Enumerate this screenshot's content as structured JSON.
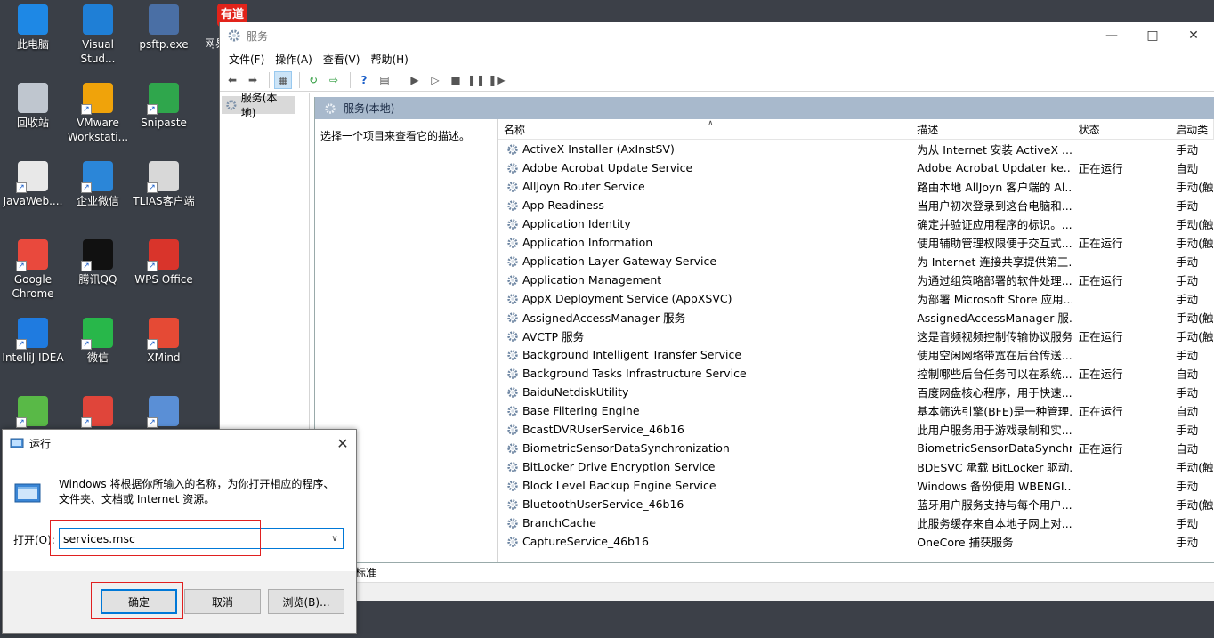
{
  "desktop": {
    "icons": [
      {
        "label": "此电脑",
        "icon": "computer-icon",
        "color": "#1e88e5"
      },
      {
        "label": "Visual Stud...",
        "icon": "vscode-icon",
        "color": "#1f7fd6"
      },
      {
        "label": "psftp.exe",
        "icon": "putty-icon",
        "color": "#4a6fa5"
      },
      {
        "label": "回收站",
        "icon": "recycle-bin-icon",
        "color": "#bfc6cf"
      },
      {
        "label": "VMware Workstati...",
        "icon": "vmware-icon",
        "color": "#f0a30a"
      },
      {
        "label": "Snipaste",
        "icon": "snipaste-icon",
        "color": "#2fa64c"
      },
      {
        "label": "JavaWeb....",
        "icon": "markdown-file-icon",
        "color": "#e8e8e8"
      },
      {
        "label": "企业微信",
        "icon": "wecom-icon",
        "color": "#2b86d8"
      },
      {
        "label": "TLIAS客户端",
        "icon": "tlias-icon",
        "color": "#d8d8d8"
      },
      {
        "label": "Google Chrome",
        "icon": "chrome-icon",
        "color": "#e9493d"
      },
      {
        "label": "腾讯QQ",
        "icon": "qq-icon",
        "color": "#111111"
      },
      {
        "label": "WPS Office",
        "icon": "wps-icon",
        "color": "#d9342b"
      },
      {
        "label": "IntelliJ IDEA",
        "icon": "intellij-icon",
        "color": "#1f7be0"
      },
      {
        "label": "微信",
        "icon": "wechat-icon",
        "color": "#28b74a"
      },
      {
        "label": "XMind",
        "icon": "xmind-icon",
        "color": "#e54a35"
      },
      {
        "label": "",
        "icon": "green-app-icon",
        "color": "#59b947"
      },
      {
        "label": "",
        "icon": "red-doc-icon",
        "color": "#e0453a"
      },
      {
        "label": "",
        "icon": "search-tool-icon",
        "color": "#5a8fd6"
      }
    ],
    "youdao_badge": "有道",
    "youdao_label": "网易"
  },
  "services_window": {
    "title": "服务",
    "menu": [
      "文件(F)",
      "操作(A)",
      "查看(V)",
      "帮助(H)"
    ],
    "tree_node": "服务(本地)",
    "pane_title": "服务(本地)",
    "desc_prompt": "选择一个项目来查看它的描述。",
    "columns": [
      "名称",
      "描述",
      "状态",
      "启动类"
    ],
    "rows": [
      {
        "name": "ActiveX Installer (AxInstSV)",
        "desc": "为从 Internet 安装 ActiveX ...",
        "state": "",
        "start": "手动"
      },
      {
        "name": "Adobe Acrobat Update Service",
        "desc": "Adobe Acrobat Updater ke...",
        "state": "正在运行",
        "start": "自动"
      },
      {
        "name": "AllJoyn Router Service",
        "desc": "路由本地 AllJoyn 客户端的 Al...",
        "state": "",
        "start": "手动(触"
      },
      {
        "name": "App Readiness",
        "desc": "当用户初次登录到这台电脑和...",
        "state": "",
        "start": "手动"
      },
      {
        "name": "Application Identity",
        "desc": "确定并验证应用程序的标识。...",
        "state": "",
        "start": "手动(触"
      },
      {
        "name": "Application Information",
        "desc": "使用辅助管理权限便于交互式...",
        "state": "正在运行",
        "start": "手动(触"
      },
      {
        "name": "Application Layer Gateway Service",
        "desc": "为 Internet 连接共享提供第三...",
        "state": "",
        "start": "手动"
      },
      {
        "name": "Application Management",
        "desc": "为通过组策略部署的软件处理...",
        "state": "正在运行",
        "start": "手动"
      },
      {
        "name": "AppX Deployment Service (AppXSVC)",
        "desc": "为部署 Microsoft Store 应用...",
        "state": "",
        "start": "手动"
      },
      {
        "name": "AssignedAccessManager 服务",
        "desc": "AssignedAccessManager 服...",
        "state": "",
        "start": "手动(触"
      },
      {
        "name": "AVCTP 服务",
        "desc": "这是音频视频控制传输协议服务",
        "state": "正在运行",
        "start": "手动(触"
      },
      {
        "name": "Background Intelligent Transfer Service",
        "desc": "使用空闲网络带宽在后台传送...",
        "state": "",
        "start": "手动"
      },
      {
        "name": "Background Tasks Infrastructure Service",
        "desc": "控制哪些后台任务可以在系统...",
        "state": "正在运行",
        "start": "自动"
      },
      {
        "name": "BaiduNetdiskUtility",
        "desc": "百度网盘核心程序，用于快速...",
        "state": "",
        "start": "手动"
      },
      {
        "name": "Base Filtering Engine",
        "desc": "基本筛选引擎(BFE)是一种管理...",
        "state": "正在运行",
        "start": "自动"
      },
      {
        "name": "BcastDVRUserService_46b16",
        "desc": "此用户服务用于游戏录制和实...",
        "state": "",
        "start": "手动"
      },
      {
        "name": "BiometricSensorDataSynchronization",
        "desc": "BiometricSensorDataSynchr...",
        "state": "正在运行",
        "start": "自动"
      },
      {
        "name": "BitLocker Drive Encryption Service",
        "desc": "BDESVC 承载 BitLocker 驱动...",
        "state": "",
        "start": "手动(触"
      },
      {
        "name": "Block Level Backup Engine Service",
        "desc": "Windows 备份使用 WBENGI...",
        "state": "",
        "start": "手动"
      },
      {
        "name": "BluetoothUserService_46b16",
        "desc": "蓝牙用户服务支持与每个用户...",
        "state": "",
        "start": "手动(触"
      },
      {
        "name": "BranchCache",
        "desc": "此服务缓存来自本地子网上对...",
        "state": "",
        "start": "手动"
      },
      {
        "name": "CaptureService_46b16",
        "desc": "OneCore 捕获服务",
        "state": "",
        "start": "手动"
      }
    ],
    "tab_label": "标准"
  },
  "run_dialog": {
    "title": "运行",
    "message": "Windows 将根据你所输入的名称，为你打开相应的程序、文件夹、文档或 Internet 资源。",
    "open_label": "打开(O):",
    "input_value": "services.msc",
    "ok_label": "确定",
    "cancel_label": "取消",
    "browse_label": "浏览(B)...",
    "accent_color": "#0078d7",
    "highlight_color": "#e02020"
  }
}
